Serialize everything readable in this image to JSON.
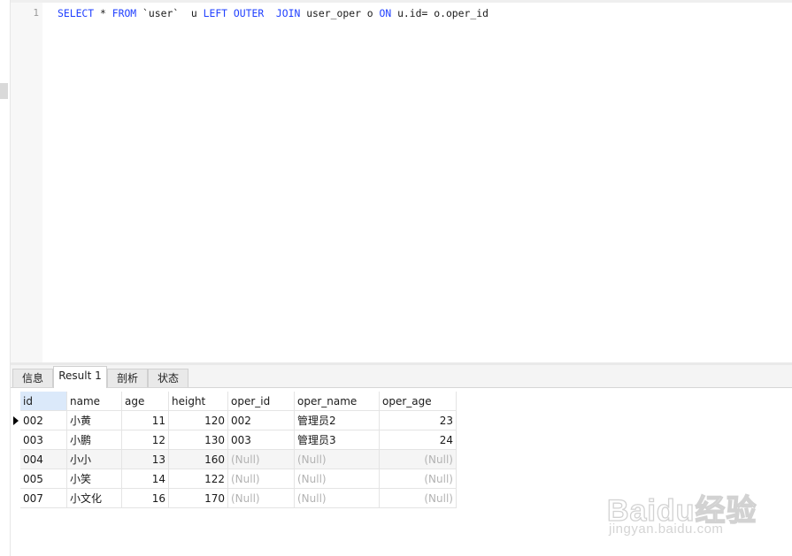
{
  "editor": {
    "line_number": "1",
    "sql_tokens": [
      {
        "t": "SELECT",
        "kw": true
      },
      {
        "t": " * ",
        "kw": false
      },
      {
        "t": "FROM",
        "kw": true
      },
      {
        "t": " `user`  u ",
        "kw": false
      },
      {
        "t": "LEFT OUTER",
        "kw": true
      },
      {
        "t": "  ",
        "kw": false
      },
      {
        "t": "JOIN",
        "kw": true
      },
      {
        "t": " user_oper o ",
        "kw": false
      },
      {
        "t": "ON",
        "kw": true
      },
      {
        "t": " u.id= o.oper_id",
        "kw": false
      }
    ]
  },
  "tabs": [
    {
      "label": "信息",
      "active": false
    },
    {
      "label": "Result 1",
      "active": true
    },
    {
      "label": "剖析",
      "active": false
    },
    {
      "label": "状态",
      "active": false
    }
  ],
  "grid": {
    "columns": [
      {
        "label": "id",
        "align": "left"
      },
      {
        "label": "name",
        "align": "left"
      },
      {
        "label": "age",
        "align": "right"
      },
      {
        "label": "height",
        "align": "right"
      },
      {
        "label": "oper_id",
        "align": "left"
      },
      {
        "label": "oper_name",
        "align": "left"
      },
      {
        "label": "oper_age",
        "align": "right"
      }
    ],
    "rows": [
      [
        "002",
        "小黄",
        "11",
        "120",
        "002",
        "管理员2",
        "23"
      ],
      [
        "003",
        "小鹏",
        "12",
        "130",
        "003",
        "管理员3",
        "24"
      ],
      [
        "004",
        "小小",
        "13",
        "160",
        "(Null)",
        "(Null)",
        "(Null)"
      ],
      [
        "005",
        "小笑",
        "14",
        "122",
        "(Null)",
        "(Null)",
        "(Null)"
      ],
      [
        "007",
        "小文化",
        "16",
        "170",
        "(Null)",
        "(Null)",
        "(Null)"
      ]
    ],
    "current_row": 0
  },
  "watermark": {
    "brand": "Baidu经验",
    "url": "jingyan.baidu.com"
  }
}
